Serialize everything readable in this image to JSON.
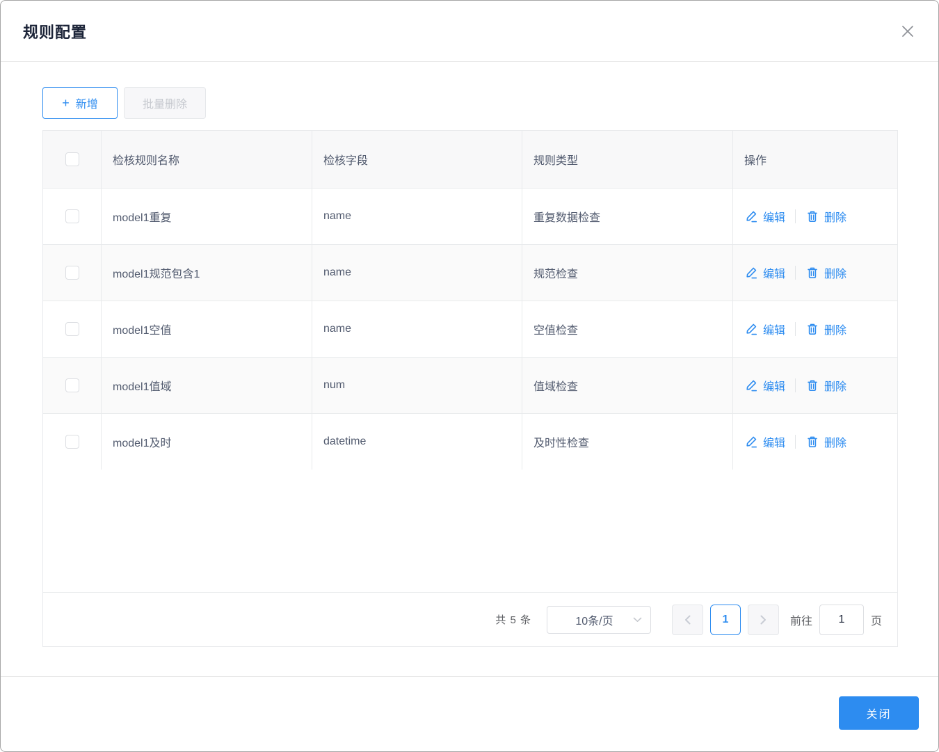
{
  "dialog": {
    "title": "规则配置"
  },
  "toolbar": {
    "add_label": "新增",
    "add_icon": "+",
    "batch_delete_label": "批量删除"
  },
  "table": {
    "columns": [
      "检核规则名称",
      "检核字段",
      "规则类型",
      "操作"
    ],
    "rows": [
      {
        "name": "model1重复",
        "field": "name",
        "type": "重复数据检查"
      },
      {
        "name": "model1规范包含1",
        "field": "name",
        "type": "规范检查"
      },
      {
        "name": "model1空值",
        "field": "name",
        "type": "空值检查"
      },
      {
        "name": "model1值域",
        "field": "num",
        "type": "值域检查"
      },
      {
        "name": "model1及时",
        "field": "datetime",
        "type": "及时性检查"
      }
    ],
    "actions": {
      "edit": "编辑",
      "delete": "删除"
    }
  },
  "pagination": {
    "total_text": "共 5 条",
    "page_size": "10条/页",
    "current_page": "1",
    "goto_label": "前往",
    "goto_value": "1",
    "page_unit": "页"
  },
  "footer": {
    "close_label": "关闭"
  },
  "icons": {
    "close": "close-icon",
    "plus": "plus-icon",
    "edit": "edit-pencil-icon",
    "delete": "trash-icon",
    "chevron_down": "chevron-down-icon",
    "chevron_left": "chevron-left-icon",
    "chevron_right": "chevron-right-icon"
  },
  "colors": {
    "accent": "#2d8cf0",
    "disabled_text": "#c5c8ce",
    "table_border": "#e8eaec",
    "header_bg": "#f8f8f9",
    "stripe_bg": "#fafafa",
    "body_text": "#515a6e",
    "title_text": "#1c2438"
  }
}
